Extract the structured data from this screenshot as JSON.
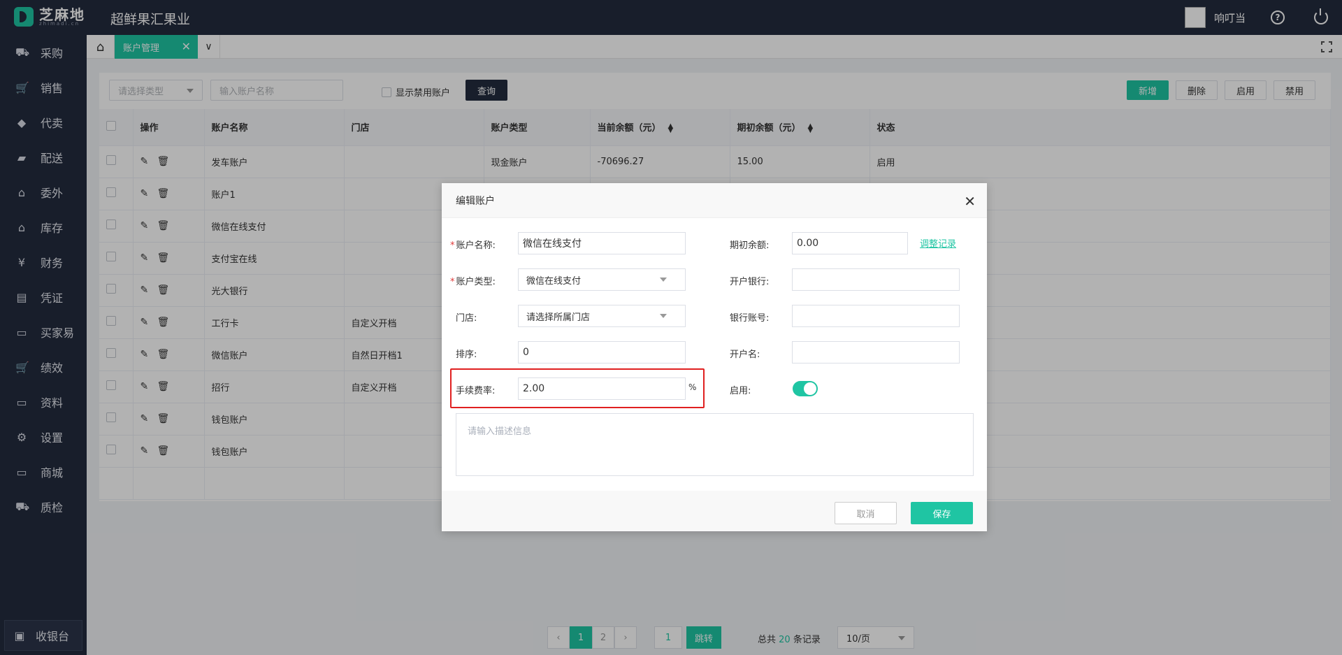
{
  "app": {
    "logo_text": "芝麻地",
    "logo_sub": "zhimadi.cn",
    "company": "超鲜果汇果业",
    "username": "响叮当",
    "help_symbol": "?",
    "accent": "#1fc5a3",
    "dark": "#232b3e"
  },
  "sidebar": {
    "items": [
      {
        "label": "采购",
        "icon": "basket-icon"
      },
      {
        "label": "销售",
        "icon": "cart-icon"
      },
      {
        "label": "代卖",
        "icon": "tag-icon"
      },
      {
        "label": "配送",
        "icon": "truck-icon"
      },
      {
        "label": "委外",
        "icon": "outsource-icon"
      },
      {
        "label": "库存",
        "icon": "warehouse-icon"
      },
      {
        "label": "财务",
        "icon": "yuan-shield-icon"
      },
      {
        "label": "凭证",
        "icon": "voucher-icon"
      },
      {
        "label": "买家易",
        "icon": "store-icon"
      },
      {
        "label": "绩效",
        "icon": "cart-icon"
      },
      {
        "label": "资料",
        "icon": "printer-icon"
      },
      {
        "label": "设置",
        "icon": "gear-icon"
      },
      {
        "label": "商城",
        "icon": "shop-icon"
      },
      {
        "label": "质检",
        "icon": "basket-icon"
      }
    ],
    "cashier": "收银台"
  },
  "tabs": {
    "active_label": "账户管理",
    "close_symbol": "✕"
  },
  "toolbar": {
    "type_placeholder": "请选择类型",
    "name_placeholder": "输入账户名称",
    "show_disabled_label": "显示禁用账户",
    "query_label": "查询",
    "add_label": "新增",
    "delete_label": "删除",
    "enable_label": "启用",
    "disable_label": "禁用"
  },
  "table": {
    "headers": [
      "操作",
      "账户名称",
      "门店",
      "账户类型",
      "当前余额（元）",
      "期初余额（元）",
      "状态"
    ],
    "rows": [
      {
        "name": "发车账户",
        "store": "",
        "type": "现金账户",
        "balance": "-70696.27",
        "initial": "15.00",
        "status": "启用"
      },
      {
        "name": "账户1",
        "store": "",
        "type": "",
        "balance": "",
        "initial": "",
        "status": ""
      },
      {
        "name": "微信在线支付",
        "store": "",
        "type": "",
        "balance": "",
        "initial": "",
        "status": ""
      },
      {
        "name": "支付宝在线",
        "store": "",
        "type": "",
        "balance": "",
        "initial": "",
        "status": ""
      },
      {
        "name": "光大银行",
        "store": "",
        "type": "",
        "balance": "",
        "initial": "",
        "status": ""
      },
      {
        "name": "工行卡",
        "store": "自定义开档",
        "type": "",
        "balance": "",
        "initial": "",
        "status": ""
      },
      {
        "name": "微信账户",
        "store": "自然日开档1",
        "type": "",
        "balance": "",
        "initial": "",
        "status": ""
      },
      {
        "name": "招行",
        "store": "自定义开档",
        "type": "",
        "balance": "",
        "initial": "",
        "status": ""
      },
      {
        "name": "钱包账户",
        "store": "",
        "type": "",
        "balance": "",
        "initial": "",
        "status": ""
      },
      {
        "name": "钱包账户",
        "store": "",
        "type": "",
        "balance": "",
        "initial": "",
        "status": ""
      }
    ]
  },
  "pagination": {
    "prev": "‹",
    "next": "›",
    "pages": [
      "1",
      "2"
    ],
    "current": "1",
    "jump_value": "1",
    "jump_label": "跳转",
    "total_prefix": "总共",
    "total": "20",
    "total_suffix": "条记录",
    "page_size": "10/页"
  },
  "modal": {
    "title": "编辑账户",
    "close_symbol": "✕",
    "account_name_label": "账户名称:",
    "account_name_value": "微信在线支付",
    "account_type_label": "账户类型:",
    "account_type_value": "微信在线支付",
    "store_label": "门店:",
    "store_placeholder": "请选择所属门店",
    "sort_label": "排序:",
    "sort_value": "0",
    "fee_label": "手续费率:",
    "fee_value": "2.00",
    "fee_unit": "%",
    "initial_label": "期初余额:",
    "initial_value": "0.00",
    "adjust_link": "调整记录",
    "bank_label": "开户银行:",
    "bank_value": "",
    "bank_account_label": "银行账号:",
    "bank_account_value": "",
    "holder_label": "开户名:",
    "holder_value": "",
    "enabled_label": "启用:",
    "enabled": true,
    "desc_placeholder": "请输入描述信息",
    "cancel_label": "取消",
    "save_label": "保存",
    "required_mark": "*"
  }
}
